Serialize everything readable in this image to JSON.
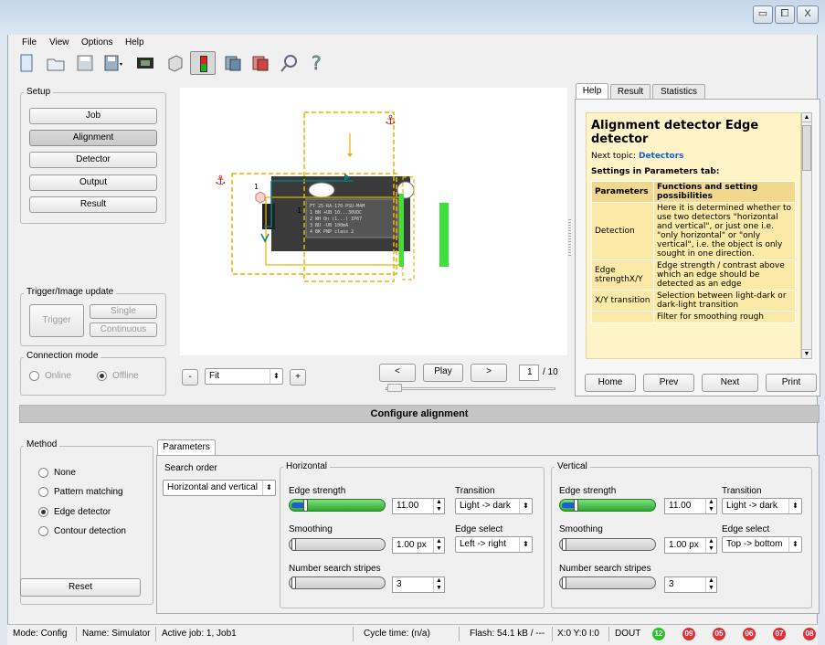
{
  "window": {
    "minimize": "▭",
    "maximize": "⧠",
    "close": "X"
  },
  "menu": [
    "File",
    "View",
    "Options",
    "Help"
  ],
  "toolbar_icons": [
    "new-job-icon",
    "open-icon",
    "save-icon",
    "save-as-icon",
    "film-icon",
    "sensor-icon",
    "trigger-icon",
    "layers-icon",
    "layers-red-icon",
    "search-icon",
    "help-icon"
  ],
  "setup": {
    "title": "Setup",
    "buttons": [
      "Job",
      "Alignment",
      "Detector",
      "Output",
      "Result"
    ],
    "active": "Alignment"
  },
  "trigger": {
    "title": "Trigger/Image update",
    "trigger": "Trigger",
    "single": "Single",
    "continuous": "Continuous"
  },
  "connection": {
    "title": "Connection mode",
    "online": "Online",
    "offline": "Offline",
    "selected": "Offline"
  },
  "image": {
    "zoom_minus": "-",
    "zoom_value": "Fit",
    "zoom_plus": "+",
    "prev": "<",
    "play": "Play",
    "next": ">",
    "frame": "1",
    "frame_total": "/ 10",
    "label1": "1",
    "label2": "1",
    "sensor_lines": [
      "FT 25-RA-170-PSU-M4M",
      "1 BN +UB   10...30VDC",
      "2 WH Qn (1...)  IP67",
      "3 BU -UB   100mA",
      "4 BK PNP   class 2"
    ]
  },
  "help": {
    "tabs": [
      "Help",
      "Result",
      "Statistics"
    ],
    "active_tab": "Help",
    "title": "Alignment detector Edge detector",
    "next_prefix": "Next topic:",
    "next_link": "Detectors",
    "settings": "Settings in Parameters tab:",
    "header": [
      "Parameters",
      "Functions and setting possibilities"
    ],
    "rows": [
      [
        "Detection",
        "Here it is determined whether to use two detectors \"horizontal and vertical\", or just one i.e. \"only horizontal\" or \"only vertical\", i.e. the object is only sought in one direction."
      ],
      [
        "Edge strengthX/Y",
        "Edge strength / contrast above which an edge should be detected as an edge"
      ],
      [
        "X/Y transition",
        "Selection between light-dark or dark-light transition"
      ],
      [
        "",
        "Filter for smoothing rough"
      ]
    ],
    "buttons": [
      "Home",
      "Prev",
      "Next",
      "Print"
    ]
  },
  "configure": {
    "title": "Configure alignment"
  },
  "method": {
    "title": "Method",
    "options": [
      "None",
      "Pattern matching",
      "Edge detector",
      "Contour detection"
    ],
    "selected": "Edge detector",
    "reset": "Reset"
  },
  "params": {
    "tab": "Parameters",
    "search_order_label": "Search order",
    "search_order": "Horizontal and vertical",
    "horizontal": {
      "title": "Horizontal",
      "edge_strength_label": "Edge strength",
      "edge_strength": "11.00",
      "edge_strength_level": 0.15,
      "transition_label": "Transition",
      "transition": "Light -> dark",
      "smoothing_label": "Smoothing",
      "smoothing": "1.00 px",
      "edge_select_label": "Edge select",
      "edge_select": "Left -> right",
      "stripes_label": "Number search stripes",
      "stripes": "3"
    },
    "vertical": {
      "title": "Vertical",
      "edge_strength_label": "Edge strength",
      "edge_strength": "11.00",
      "edge_strength_level": 0.15,
      "transition_label": "Transition",
      "transition": "Light -> dark",
      "smoothing_label": "Smoothing",
      "smoothing": "1.00 px",
      "edge_select_label": "Edge select",
      "edge_select": "Top -> bottom",
      "stripes_label": "Number search stripes",
      "stripes": "3"
    }
  },
  "status": {
    "mode": "Mode:  Config",
    "name": "Name:  Simulator",
    "job": "Active job:  1, Job1",
    "cycle": "Cycle time:  (n/a)",
    "flash": "Flash:  54.1 kB / ---",
    "xy": "X:0 Y:0 I:0",
    "dout": "DOUT",
    "leds": [
      {
        "label": "12",
        "color": "#2cc22c"
      },
      {
        "label": "09",
        "color": "#e0303a"
      },
      {
        "label": "05",
        "color": "#e0303a"
      },
      {
        "label": "06",
        "color": "#e0303a"
      },
      {
        "label": "07",
        "color": "#e0303a"
      },
      {
        "label": "08",
        "color": "#e0303a"
      }
    ]
  }
}
